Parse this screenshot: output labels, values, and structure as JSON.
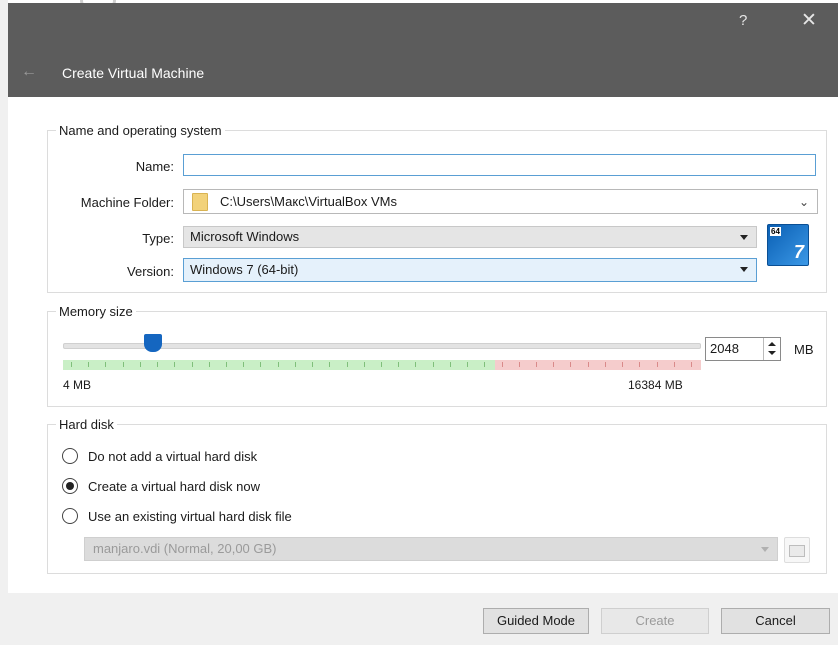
{
  "window": {
    "title": "Create Virtual Machine",
    "help_label": "?",
    "close_label": "✕",
    "back_label": "←"
  },
  "name_os": {
    "legend": "Name and operating system",
    "name_label": "Name:",
    "name_value": "",
    "folder_label": "Machine Folder:",
    "folder_value": "C:\\Users\\Макс\\VirtualBox VMs",
    "type_label": "Type:",
    "type_value": "Microsoft Windows",
    "version_label": "Version:",
    "version_value": "Windows 7 (64-bit)",
    "os_icon": {
      "badge": "64",
      "version": "7"
    }
  },
  "memory": {
    "legend": "Memory size",
    "min_label": "4 MB",
    "max_label": "16384 MB",
    "value": "2048",
    "unit": "MB",
    "slider_fraction": 0.125
  },
  "hard_disk": {
    "legend": "Hard disk",
    "options": [
      {
        "label": "Do not add a virtual hard disk",
        "checked": false
      },
      {
        "label": "Create a virtual hard disk now",
        "checked": true
      },
      {
        "label": "Use an existing virtual hard disk file",
        "checked": false
      }
    ],
    "existing_file": "manjaro.vdi (Normal, 20,00 GB)"
  },
  "footer": {
    "guided_label": "Guided Mode",
    "create_label": "Create",
    "cancel_label": "Cancel"
  },
  "colors": {
    "titlebar": "#5c5c5c",
    "slider_thumb": "#1566c0",
    "safe_zone": "#c9efc6",
    "danger_zone": "#f5cccc",
    "focus_border": "#5a9fd4"
  }
}
